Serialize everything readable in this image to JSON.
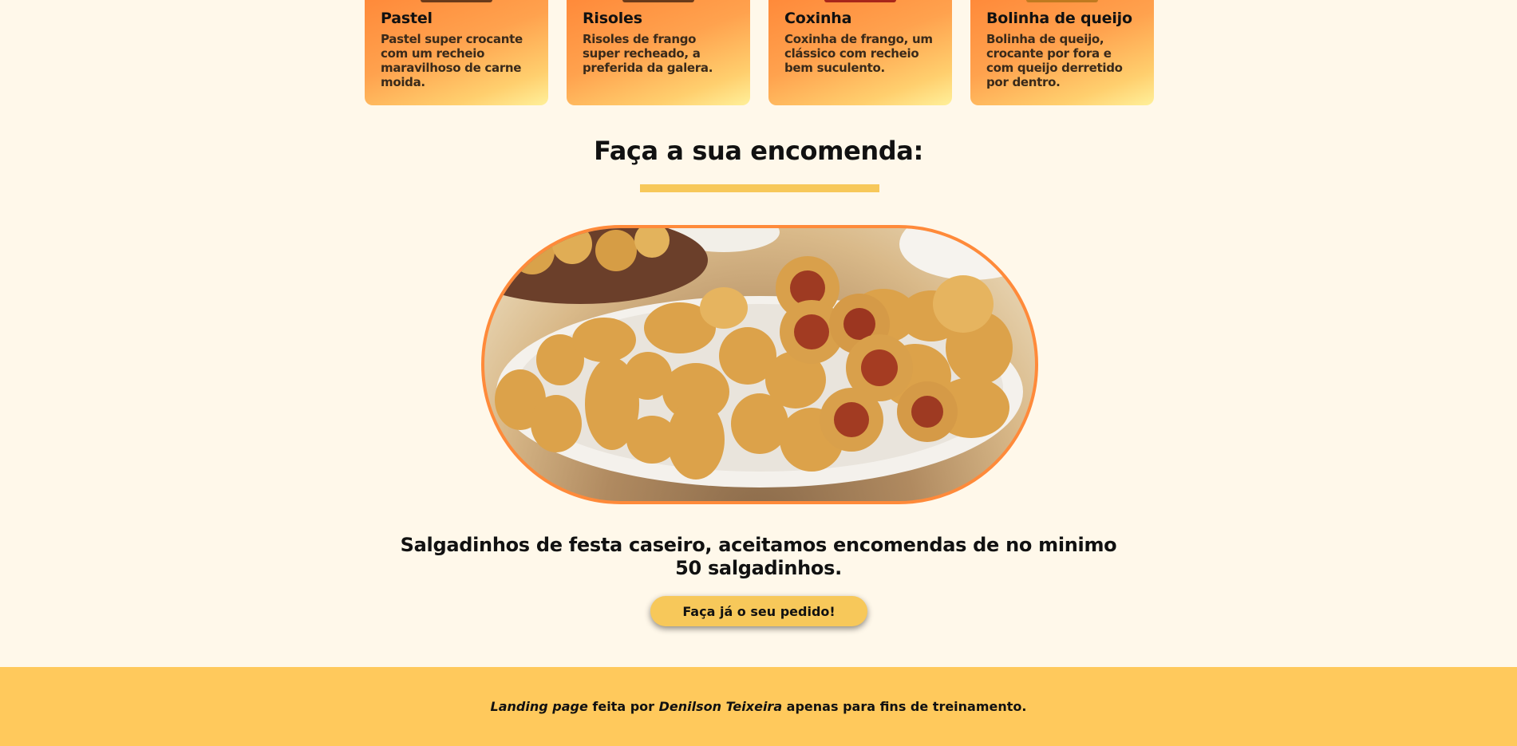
{
  "cards": [
    {
      "title": "Pastel",
      "text": "Pastel super crocante com um recheio maravilhoso de carne moida."
    },
    {
      "title": "Risoles",
      "text": "Risoles de frango super recheado, a preferida da galera."
    },
    {
      "title": "Coxinha",
      "text": "Coxinha de frango, um clássico com recheio bem suculento."
    },
    {
      "title": "Bolinha de queijo",
      "text": "Bolinha de queijo, crocante por fora e com queijo derretido por dentro."
    }
  ],
  "order": {
    "title": "Faça a sua encomenda:",
    "tagline": "Salgadinhos de festa caseiro, aceitamos encomendas de no minimo 50 salgadinhos.",
    "button_label": "Faça já o seu pedido!"
  },
  "footer": {
    "part1": "Landing page",
    "part2": " feita por ",
    "part3": "Denilson Teixeira",
    "part4": " apenas para fins de treinamento."
  },
  "colors": {
    "background": "#fff8ea",
    "accent": "#f7c85a",
    "border_orange": "#ff8a3a",
    "footer": "#ffc95c"
  }
}
